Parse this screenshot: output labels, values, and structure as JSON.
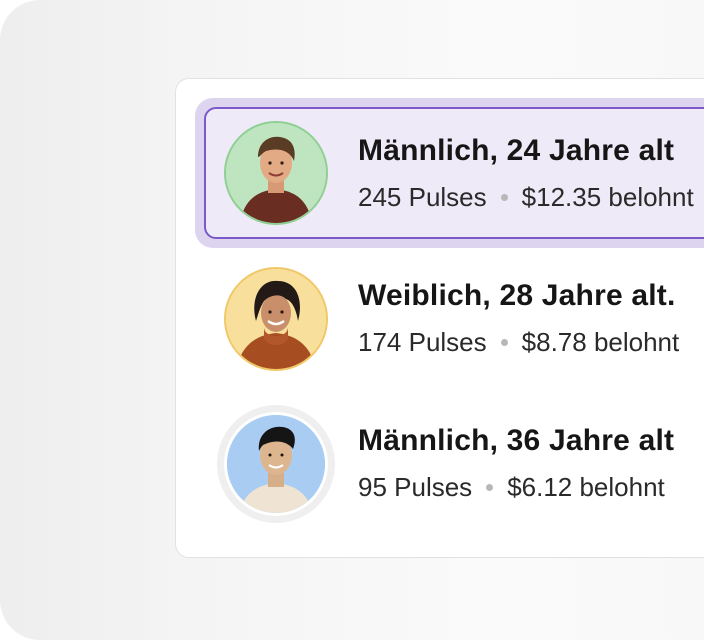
{
  "rows": [
    {
      "title": "Männlich, 24 Jahre alt",
      "pulses": "245 Pulses",
      "reward": "$12.35 belohnt",
      "selected": true,
      "avatar_icon": "young-man-avatar",
      "accent": "#7b59c9"
    },
    {
      "title": "Weiblich, 28 Jahre alt.",
      "pulses": "174 Pulses",
      "reward": "$8.78 belohnt",
      "selected": false,
      "avatar_icon": "young-woman-avatar"
    },
    {
      "title": "Männlich, 36 Jahre alt",
      "pulses": "95 Pulses",
      "reward": "$6.12 belohnt",
      "selected": false,
      "avatar_icon": "man-avatar"
    }
  ],
  "colors": {
    "selection_border": "#7b59c9",
    "selection_fill": "#efeaf8",
    "avatar_1_bg": "#bfe5c0",
    "avatar_2_bg": "#f8df9b",
    "avatar_3_bg": "#a9cdf2"
  }
}
